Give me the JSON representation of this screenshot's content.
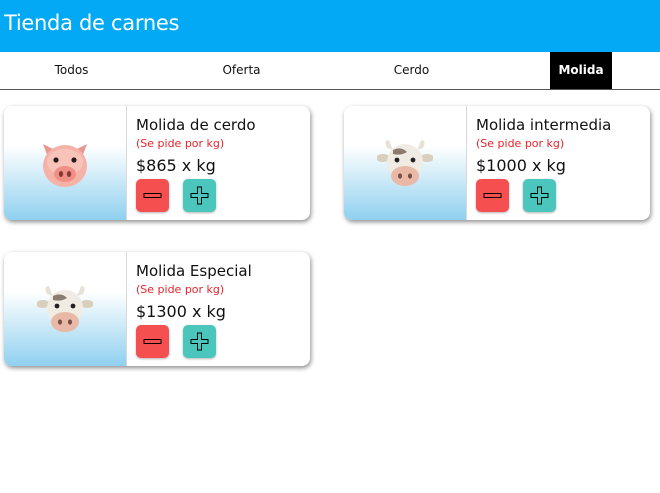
{
  "app": {
    "title": "Tienda de carnes"
  },
  "tabs": [
    {
      "label": "Todos",
      "active": false
    },
    {
      "label": "Oferta",
      "active": false
    },
    {
      "label": "Cerdo",
      "active": false
    },
    {
      "label": "Molida",
      "active": true
    }
  ],
  "products": [
    {
      "name": "Molida de cerdo",
      "note": "(Se pide por kg)",
      "price": "$865 x kg",
      "icon": "pig-face-icon"
    },
    {
      "name": "Molida intermedia",
      "note": "(Se pide por kg)",
      "price": "$1000 x kg",
      "icon": "cow-face-icon"
    },
    {
      "name": "Molida Especial",
      "note": "(Se pide por kg)",
      "price": "$1300 x kg",
      "icon": "cow-face-icon"
    }
  ],
  "colors": {
    "header": "#03a9f4",
    "active_tab": "#000000",
    "note_text": "#e8222b",
    "minus_button": "#f5504f",
    "plus_button": "#4ac6bd"
  }
}
